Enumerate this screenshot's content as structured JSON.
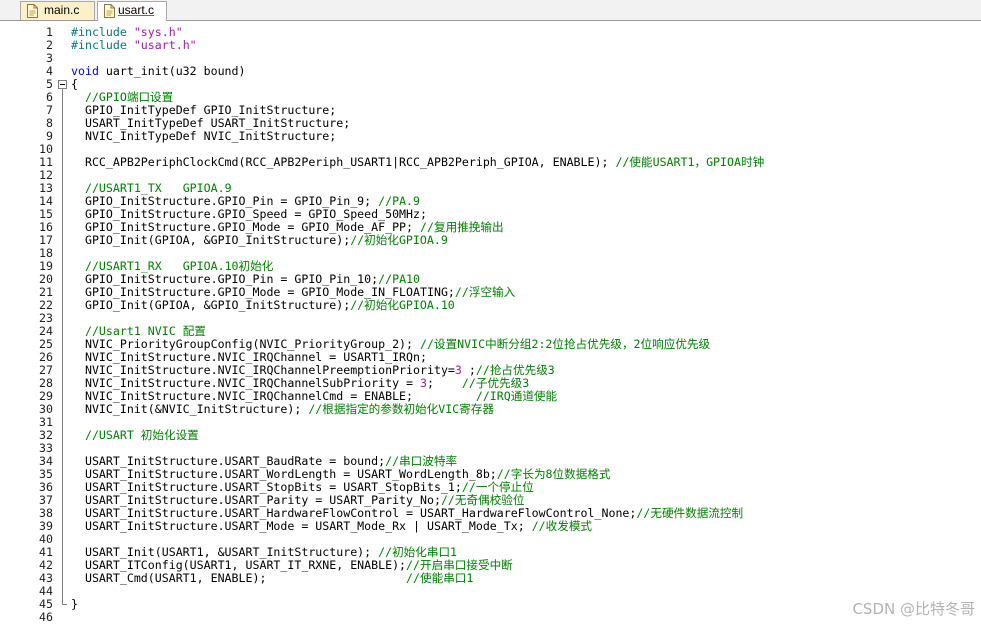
{
  "tabs": [
    {
      "label": "main.c",
      "active": false,
      "icon": "c-file-icon"
    },
    {
      "label": "usart.c",
      "active": true,
      "icon": "c-file-icon"
    }
  ],
  "colors": {
    "keyword": "#0000ff",
    "comment": "#008000",
    "preprocessor": "#007a7a",
    "string": "#a020a0",
    "number": "#a020a0",
    "text": "#000000",
    "tab_inactive": "#fbf0c8",
    "tab_active": "#ffffff",
    "watermark": "#b3b3b3"
  },
  "editor": {
    "fold_icon": "fold-collapse-icon",
    "lines": [
      {
        "n": 1,
        "segs": [
          [
            "pp",
            "#include"
          ],
          [
            "txt",
            " "
          ],
          [
            "str",
            "\"sys.h\""
          ]
        ]
      },
      {
        "n": 2,
        "segs": [
          [
            "pp",
            "#include"
          ],
          [
            "txt",
            " "
          ],
          [
            "str",
            "\"usart.h\""
          ]
        ]
      },
      {
        "n": 3,
        "segs": []
      },
      {
        "n": 4,
        "segs": [
          [
            "kw",
            "void"
          ],
          [
            "txt",
            " uart_init(u32 bound)"
          ]
        ]
      },
      {
        "n": 5,
        "segs": [
          [
            "txt",
            "{"
          ]
        ]
      },
      {
        "n": 6,
        "segs": [
          [
            "txt",
            "  "
          ],
          [
            "cm",
            "//GPIO端口设置"
          ]
        ]
      },
      {
        "n": 7,
        "segs": [
          [
            "txt",
            "  GPIO_InitTypeDef GPIO_InitStructure;"
          ]
        ]
      },
      {
        "n": 8,
        "segs": [
          [
            "txt",
            "  USART_InitTypeDef USART_InitStructure;"
          ]
        ]
      },
      {
        "n": 9,
        "segs": [
          [
            "txt",
            "  NVIC_InitTypeDef NVIC_InitStructure;"
          ]
        ]
      },
      {
        "n": 10,
        "segs": []
      },
      {
        "n": 11,
        "segs": [
          [
            "txt",
            "  RCC_APB2PeriphClockCmd(RCC_APB2Periph_USART1|RCC_APB2Periph_GPIOA, ENABLE); "
          ],
          [
            "cm",
            "//使能USART1，GPIOA时钟"
          ]
        ]
      },
      {
        "n": 12,
        "segs": []
      },
      {
        "n": 13,
        "segs": [
          [
            "txt",
            "  "
          ],
          [
            "cm",
            "//USART1_TX   GPIOA.9"
          ]
        ]
      },
      {
        "n": 14,
        "segs": [
          [
            "txt",
            "  GPIO_InitStructure.GPIO_Pin = GPIO_Pin_9; "
          ],
          [
            "cm",
            "//PA.9"
          ]
        ]
      },
      {
        "n": 15,
        "segs": [
          [
            "txt",
            "  GPIO_InitStructure.GPIO_Speed = GPIO_Speed_50MHz;"
          ]
        ]
      },
      {
        "n": 16,
        "segs": [
          [
            "txt",
            "  GPIO_InitStructure.GPIO_Mode = GPIO_Mode_AF_PP; "
          ],
          [
            "cm",
            "//复用推挽输出"
          ]
        ]
      },
      {
        "n": 17,
        "segs": [
          [
            "txt",
            "  GPIO_Init(GPIOA, &GPIO_InitStructure);"
          ],
          [
            "cm",
            "//初始化GPIOA.9"
          ]
        ]
      },
      {
        "n": 18,
        "segs": []
      },
      {
        "n": 19,
        "segs": [
          [
            "txt",
            "  "
          ],
          [
            "cm",
            "//USART1_RX   GPIOA.10初始化"
          ]
        ]
      },
      {
        "n": 20,
        "segs": [
          [
            "txt",
            "  GPIO_InitStructure.GPIO_Pin = GPIO_Pin_10;"
          ],
          [
            "cm",
            "//PA10"
          ]
        ]
      },
      {
        "n": 21,
        "segs": [
          [
            "txt",
            "  GPIO_InitStructure.GPIO_Mode = GPIO_Mode_IN_FLOATING;"
          ],
          [
            "cm",
            "//浮空输入"
          ]
        ]
      },
      {
        "n": 22,
        "segs": [
          [
            "txt",
            "  GPIO_Init(GPIOA, &GPIO_InitStructure);"
          ],
          [
            "cm",
            "//初始化GPIOA.10"
          ]
        ]
      },
      {
        "n": 23,
        "segs": []
      },
      {
        "n": 24,
        "segs": [
          [
            "txt",
            "  "
          ],
          [
            "cm",
            "//Usart1 NVIC 配置"
          ]
        ]
      },
      {
        "n": 25,
        "segs": [
          [
            "txt",
            "  NVIC_PriorityGroupConfig(NVIC_PriorityGroup_2); "
          ],
          [
            "cm",
            "//设置NVIC中断分组2:2位抢占优先级，2位响应优先级"
          ]
        ]
      },
      {
        "n": 26,
        "segs": [
          [
            "txt",
            "  NVIC_InitStructure.NVIC_IRQChannel = USART1_IRQn;"
          ]
        ]
      },
      {
        "n": 27,
        "segs": [
          [
            "txt",
            "  NVIC_InitStructure.NVIC_IRQChannelPreemptionPriority="
          ],
          [
            "num",
            "3"
          ],
          [
            "txt",
            " ;"
          ],
          [
            "cm",
            "//抢占优先级3"
          ]
        ]
      },
      {
        "n": 28,
        "segs": [
          [
            "txt",
            "  NVIC_InitStructure.NVIC_IRQChannelSubPriority = "
          ],
          [
            "num",
            "3"
          ],
          [
            "txt",
            ";    "
          ],
          [
            "cm",
            "//子优先级3"
          ]
        ]
      },
      {
        "n": 29,
        "segs": [
          [
            "txt",
            "  NVIC_InitStructure.NVIC_IRQChannelCmd = ENABLE;         "
          ],
          [
            "cm",
            "//IRQ通道使能"
          ]
        ]
      },
      {
        "n": 30,
        "segs": [
          [
            "txt",
            "  NVIC_Init(&NVIC_InitStructure); "
          ],
          [
            "cm",
            "//根据指定的参数初始化VIC寄存器"
          ]
        ]
      },
      {
        "n": 31,
        "segs": []
      },
      {
        "n": 32,
        "segs": [
          [
            "txt",
            "  "
          ],
          [
            "cm",
            "//USART 初始化设置"
          ]
        ]
      },
      {
        "n": 33,
        "segs": []
      },
      {
        "n": 34,
        "segs": [
          [
            "txt",
            "  USART_InitStructure.USART_BaudRate = bound;"
          ],
          [
            "cm",
            "//串口波特率"
          ]
        ]
      },
      {
        "n": 35,
        "segs": [
          [
            "txt",
            "  USART_InitStructure.USART_WordLength = USART_WordLength_8b;"
          ],
          [
            "cm",
            "//字长为8位数据格式"
          ]
        ]
      },
      {
        "n": 36,
        "segs": [
          [
            "txt",
            "  USART_InitStructure.USART_StopBits = USART_StopBits_1;"
          ],
          [
            "cm",
            "//一个停止位"
          ]
        ]
      },
      {
        "n": 37,
        "segs": [
          [
            "txt",
            "  USART_InitStructure.USART_Parity = USART_Parity_No;"
          ],
          [
            "cm",
            "//无奇偶校验位"
          ]
        ]
      },
      {
        "n": 38,
        "segs": [
          [
            "txt",
            "  USART_InitStructure.USART_HardwareFlowControl = USART_HardwareFlowControl_None;"
          ],
          [
            "cm",
            "//无硬件数据流控制"
          ]
        ]
      },
      {
        "n": 39,
        "segs": [
          [
            "txt",
            "  USART_InitStructure.USART_Mode = USART_Mode_Rx | USART_Mode_Tx; "
          ],
          [
            "cm",
            "//收发模式"
          ]
        ]
      },
      {
        "n": 40,
        "segs": []
      },
      {
        "n": 41,
        "segs": [
          [
            "txt",
            "  USART_Init(USART1, &USART_InitStructure); "
          ],
          [
            "cm",
            "//初始化串口1"
          ]
        ]
      },
      {
        "n": 42,
        "segs": [
          [
            "txt",
            "  USART_ITConfig(USART1, USART_IT_RXNE, ENABLE);"
          ],
          [
            "cm",
            "//开启串口接受中断"
          ]
        ]
      },
      {
        "n": 43,
        "segs": [
          [
            "txt",
            "  USART_Cmd(USART1, ENABLE);                    "
          ],
          [
            "cm",
            "//使能串口1"
          ]
        ]
      },
      {
        "n": 44,
        "segs": []
      },
      {
        "n": 45,
        "segs": [
          [
            "txt",
            "}"
          ]
        ]
      },
      {
        "n": 46,
        "segs": []
      }
    ]
  },
  "watermark": "CSDN @比特冬哥"
}
